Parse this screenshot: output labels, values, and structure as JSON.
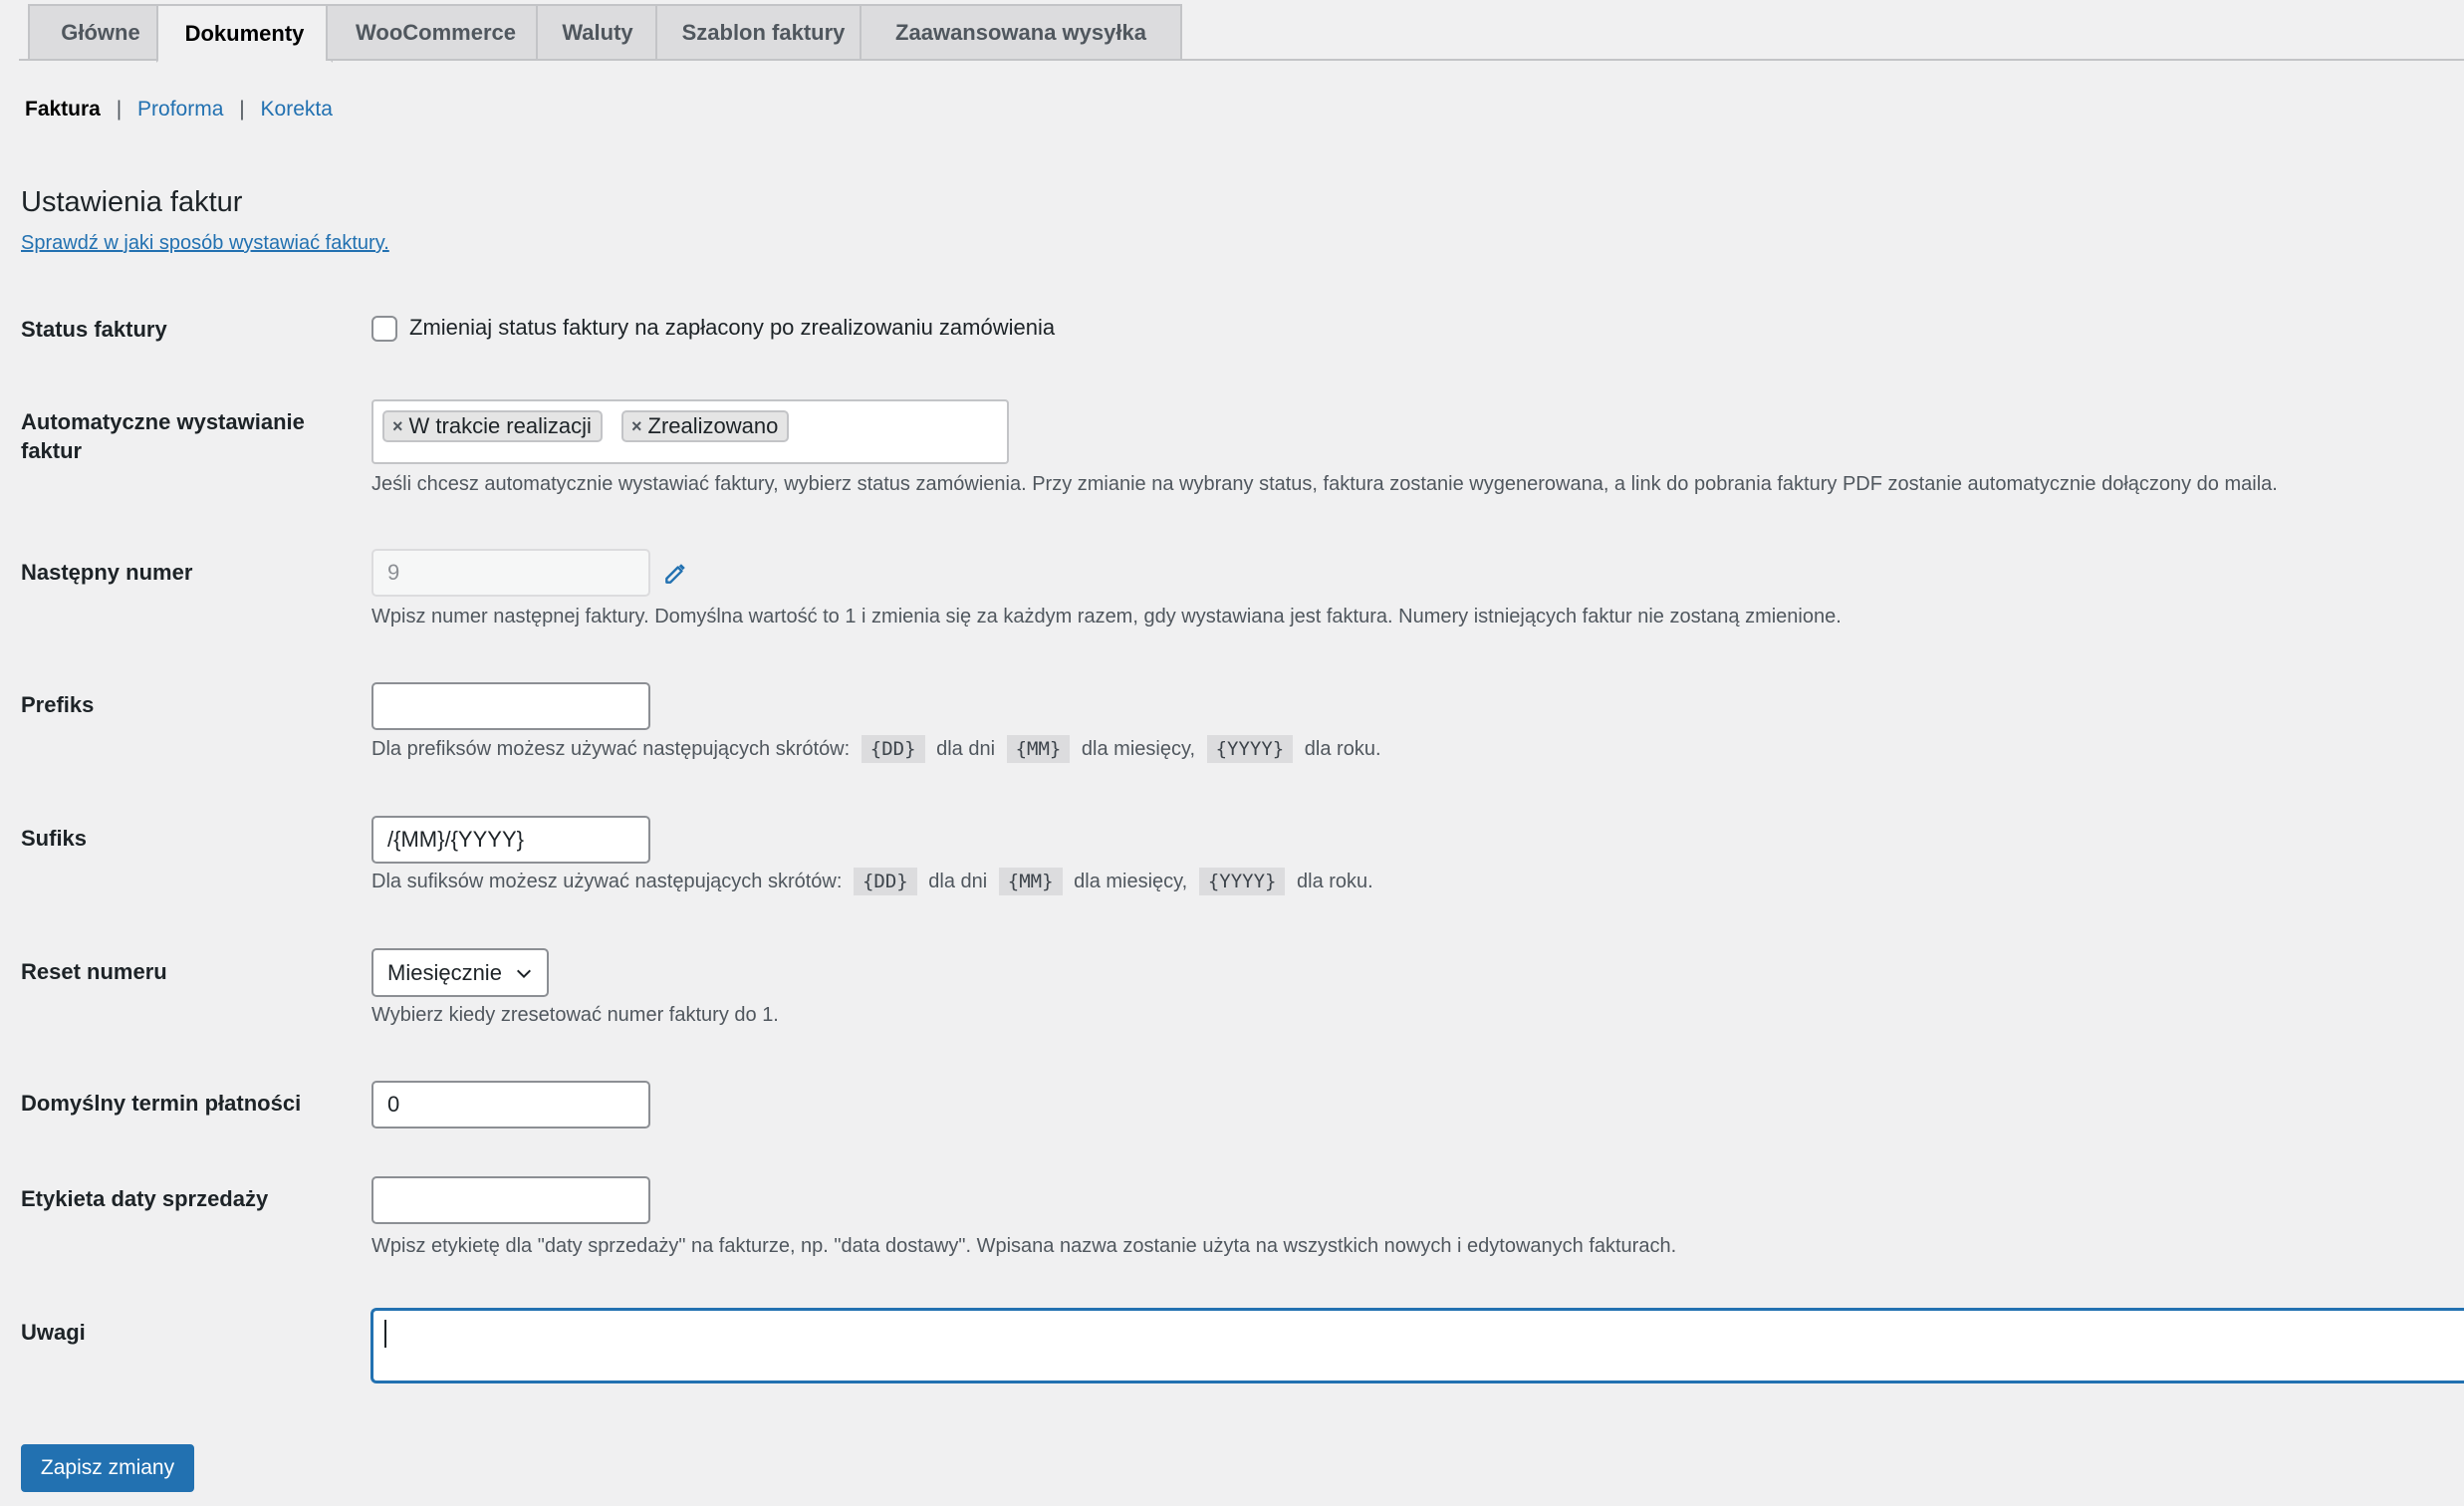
{
  "tabs": [
    {
      "label": "Główne",
      "active": false
    },
    {
      "label": "Dokumenty",
      "active": true
    },
    {
      "label": "WooCommerce",
      "active": false
    },
    {
      "label": "Waluty",
      "active": false
    },
    {
      "label": "Szablon faktury",
      "active": false
    },
    {
      "label": "Zaawansowana wysyłka",
      "active": false
    }
  ],
  "subnav": {
    "current": "Faktura",
    "links": [
      "Proforma",
      "Korekta"
    ],
    "separator": "|"
  },
  "section": {
    "title": "Ustawienia faktur",
    "help_link": "Sprawdź w jaki sposób wystawiać faktury."
  },
  "fields": {
    "status": {
      "label": "Status faktury",
      "checkbox_label": "Zmieniaj status faktury na zapłacony po zrealizowaniu zamówienia",
      "checked": false
    },
    "auto": {
      "label": "Automatyczne wystawianie faktur",
      "chips": [
        "W trakcie realizacji",
        "Zrealizowano"
      ],
      "chip_remove": "×",
      "description": "Jeśli chcesz automatycznie wystawiać faktury, wybierz status zamówienia. Przy zmianie na wybrany status, faktura zostanie wygenerowana, a link do pobrania faktury PDF zostanie automatycznie dołączony do maila."
    },
    "next_number": {
      "label": "Następny numer",
      "value": "9",
      "description": "Wpisz numer następnej faktury. Domyślna wartość to 1 i zmienia się za każdym razem, gdy wystawiana jest faktura. Numery istniejących faktur nie zostaną zmienione."
    },
    "prefix": {
      "label": "Prefiks",
      "value": "",
      "desc_start": "Dla prefiksów możesz używać następujących skrótów:",
      "code_dd": "{DD}",
      "text_days": "dla dni",
      "code_mm": "{MM}",
      "text_months": "dla miesięcy,",
      "code_yyyy": "{YYYY}",
      "text_year": "dla roku."
    },
    "suffix": {
      "label": "Sufiks",
      "value": "/{MM}/{YYYY}",
      "desc_start": "Dla sufiksów możesz używać następujących skrótów:",
      "code_dd": "{DD}",
      "text_days": "dla dni",
      "code_mm": "{MM}",
      "text_months": "dla miesięcy,",
      "code_yyyy": "{YYYY}",
      "text_year": "dla roku."
    },
    "reset": {
      "label": "Reset numeru",
      "value": "Miesięcznie",
      "description": "Wybierz kiedy zresetować numer faktury do 1."
    },
    "payment_term": {
      "label": "Domyślny termin płatności",
      "value": "0"
    },
    "sale_date_label": {
      "label": "Etykieta daty sprzedaży",
      "value": "",
      "description": "Wpisz etykietę dla \"daty sprzedaży\" na fakturze, np. \"data dostawy\". Wpisana nazwa zostanie użyta na wszystkich nowych i edytowanych fakturach."
    },
    "notes": {
      "label": "Uwagi",
      "value": ""
    }
  },
  "save_button": "Zapisz zmiany",
  "colors": {
    "accent": "#2271b1",
    "background": "#f0f0f1",
    "text": "#1d2327",
    "muted": "#50575e"
  }
}
